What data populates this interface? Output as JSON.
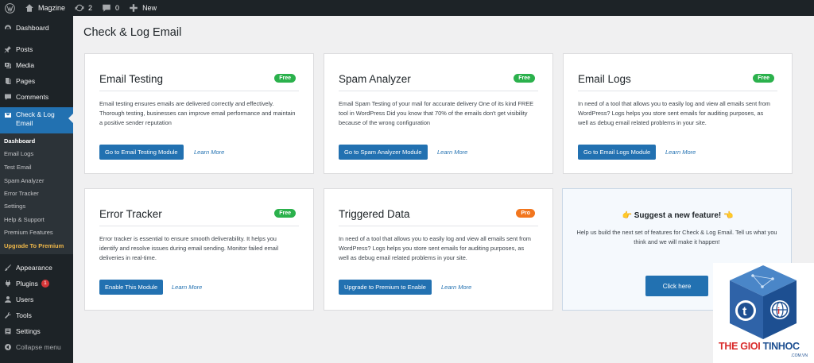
{
  "adminbar": {
    "site_name": "Magzine",
    "updates_count": "2",
    "comments_count": "0",
    "new_label": "New"
  },
  "sidebar": {
    "items": [
      {
        "label": "Dashboard",
        "icon": "dashboard-icon"
      },
      {
        "label": "Posts",
        "icon": "pin-icon"
      },
      {
        "label": "Media",
        "icon": "media-icon"
      },
      {
        "label": "Pages",
        "icon": "pages-icon"
      },
      {
        "label": "Comments",
        "icon": "comment-icon"
      },
      {
        "label": "Check & Log Email",
        "icon": "email-icon"
      },
      {
        "label": "Appearance",
        "icon": "brush-icon"
      },
      {
        "label": "Plugins",
        "icon": "plugin-icon",
        "badge": "1"
      },
      {
        "label": "Users",
        "icon": "users-icon"
      },
      {
        "label": "Tools",
        "icon": "tools-icon"
      },
      {
        "label": "Settings",
        "icon": "settings-icon"
      },
      {
        "label": "Collapse menu",
        "icon": "collapse-icon"
      }
    ],
    "submenu": [
      "Dashboard",
      "Email Logs",
      "Test Email",
      "Spam Analyzer",
      "Error Tracker",
      "Settings",
      "Help & Support",
      "Premium Features",
      "Upgrade To Premium"
    ]
  },
  "page": {
    "title": "Check & Log Email"
  },
  "cards": [
    {
      "title": "Email Testing",
      "badge": "Free",
      "desc": "Email testing ensures emails are delivered correctly and effectively. Thorough testing, businesses can improve email performance and maintain a positive sender reputation",
      "button": "Go to Email Testing Module",
      "link": "Learn More"
    },
    {
      "title": "Spam Analyzer",
      "badge": "Free",
      "desc": "Email Spam Testing of your mail for accurate delivery One of its kind FREE tool in WordPress Did you know that 70% of the emails don't get visibility because of the wrong configuration",
      "button": "Go to Spam Analyzer Module",
      "link": "Learn More"
    },
    {
      "title": "Email Logs",
      "badge": "Free",
      "desc": "In need of a tool that allows you to easily log and view all emails sent from WordPress? Logs helps you store sent emails for auditing purposes, as well as debug email related problems in your site.",
      "button": "Go to Email Logs Module",
      "link": "Learn More"
    },
    {
      "title": "Error Tracker",
      "badge": "Free",
      "desc": "Error tracker is essential to ensure smooth deliverability. It helps you identify and resolve issues during email sending. Monitor failed email deliveries in real-time.",
      "button": "Enable This Module",
      "link": "Learn More"
    },
    {
      "title": "Triggered Data",
      "badge": "Pro",
      "desc": "In need of a tool that allows you to easily log and view all emails sent from WordPress? Logs helps you store sent emails for auditing purposes, as well as debug email related problems in your site.",
      "button": "Upgrade to Premium to Enable",
      "link": "Learn More"
    }
  ],
  "suggest": {
    "title": "👉 Suggest a new feature! 👈",
    "desc": "Help us build the next set of features for Check & Log Email. Tell us what you think and we will make it happen!",
    "button": "Click here"
  },
  "watermark": {
    "brand_red": "THE GIOI",
    "brand_blue": "TINHOC",
    "domain": ".COM.VN"
  },
  "colors": {
    "admin_dark": "#1d2327",
    "accent": "#2271b1",
    "free_badge": "#2bb14c",
    "pro_badge": "#f2761e",
    "upgrade_text": "#f0b849"
  }
}
